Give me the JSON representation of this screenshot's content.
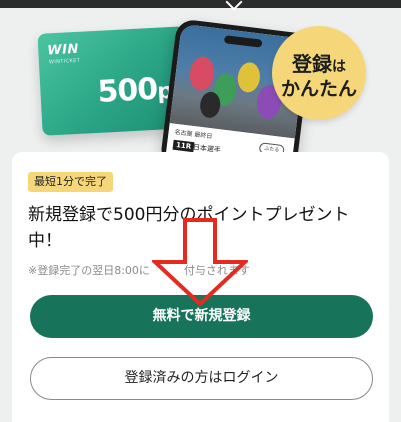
{
  "hero": {
    "card": {
      "logo": "WIN",
      "logo_sub": "WINTICKET",
      "amount": "500",
      "unit": "pt"
    },
    "phone": {
      "venue": "名古屋 最終日",
      "race_number": "11R",
      "race_name": "日本選手",
      "pill": "ふたる"
    },
    "badge": {
      "line1_big": "登録",
      "line1_small": "は",
      "line2": "かんたん"
    }
  },
  "promo": {
    "tag": "最短1分で完了",
    "headline": "新規登録で500円分のポイントプレゼント中！",
    "note_left": "※登録完了の翌日8:00に",
    "note_right": "付与されます"
  },
  "actions": {
    "register_label": "無料で新規登録",
    "login_label": "登録済みの方はログイン"
  },
  "colors": {
    "brand_green": "#17735a",
    "badge_yellow": "#f5d77a",
    "annotation_red": "#e52a20"
  },
  "icons": {
    "top_chevron": "chevron-down-icon",
    "annotation": "red-down-arrow-icon"
  }
}
